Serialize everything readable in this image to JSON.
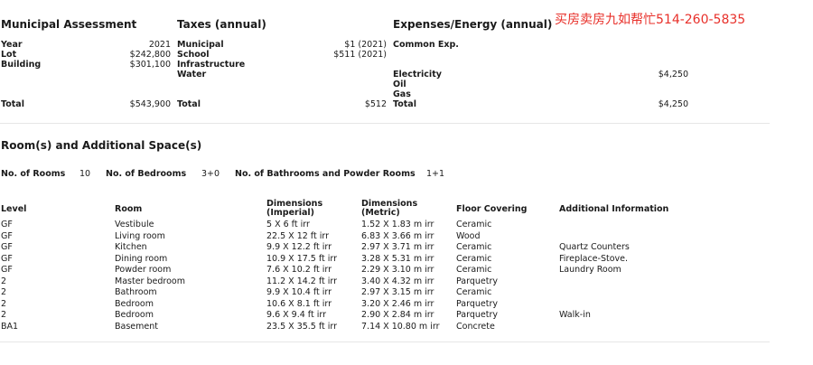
{
  "promo": "买房卖房九如帮忙514-260-5835",
  "assessment": {
    "title": "Municipal Assessment",
    "rows": [
      {
        "label": "Year",
        "value": "2021"
      },
      {
        "label": "Lot",
        "value": "$242,800"
      },
      {
        "label": "Building",
        "value": "$301,100"
      }
    ],
    "total_label": "Total",
    "total_value": "$543,900"
  },
  "taxes": {
    "title": "Taxes (annual)",
    "rows": [
      {
        "label": "Municipal",
        "value": "$1 (2021)"
      },
      {
        "label": "School",
        "value": "$511 (2021)"
      },
      {
        "label": "Infrastructure",
        "value": ""
      },
      {
        "label": "Water",
        "value": ""
      }
    ],
    "total_label": "Total",
    "total_value": "$512"
  },
  "expenses": {
    "title": "Expenses/Energy (annual)",
    "rows": [
      {
        "label": "Common Exp.",
        "value": ""
      },
      {
        "label": "Electricity",
        "value": "$4,250"
      },
      {
        "label": "Oil",
        "value": ""
      },
      {
        "label": "Gas",
        "value": ""
      }
    ],
    "total_label": "Total",
    "total_value": "$4,250"
  },
  "rooms_section": {
    "title": "Room(s) and Additional Space(s)",
    "no_rooms_label": "No. of Rooms",
    "no_rooms_value": "10",
    "no_bedrooms_label": "No. of Bedrooms",
    "no_bedrooms_value": "3+0",
    "no_baths_label": "No. of Bathrooms and Powder Rooms",
    "no_baths_value": "1+1"
  },
  "room_table": {
    "headers": {
      "level": "Level",
      "room": "Room",
      "dim_imp_1": "Dimensions",
      "dim_imp_2": "(Imperial)",
      "dim_met_1": "Dimensions",
      "dim_met_2": "(Metric)",
      "floor": "Floor Covering",
      "info": "Additional Information"
    },
    "rows": [
      {
        "level": "GF",
        "room": "Vestibule",
        "imperial": "5 X 6 ft irr",
        "metric": "1.52 X 1.83 m irr",
        "floor": "Ceramic",
        "info": ""
      },
      {
        "level": "GF",
        "room": "Living room",
        "imperial": "22.5 X 12 ft irr",
        "metric": "6.83 X 3.66 m irr",
        "floor": "Wood",
        "info": ""
      },
      {
        "level": "GF",
        "room": "Kitchen",
        "imperial": "9.9 X 12.2 ft irr",
        "metric": "2.97 X 3.71 m irr",
        "floor": "Ceramic",
        "info": "Quartz Counters"
      },
      {
        "level": "GF",
        "room": "Dining room",
        "imperial": "10.9 X 17.5 ft irr",
        "metric": "3.28 X 5.31 m irr",
        "floor": "Ceramic",
        "info": "Fireplace-Stove."
      },
      {
        "level": "GF",
        "room": "Powder room",
        "imperial": "7.6 X 10.2 ft irr",
        "metric": "2.29 X 3.10 m irr",
        "floor": "Ceramic",
        "info": "Laundry Room"
      },
      {
        "level": "2",
        "room": "Master bedroom",
        "imperial": "11.2 X 14.2 ft irr",
        "metric": "3.40 X 4.32 m irr",
        "floor": "Parquetry",
        "info": ""
      },
      {
        "level": "2",
        "room": "Bathroom",
        "imperial": "9.9 X 10.4 ft irr",
        "metric": "2.97 X 3.15 m irr",
        "floor": "Ceramic",
        "info": ""
      },
      {
        "level": "2",
        "room": "Bedroom",
        "imperial": "10.6 X 8.1 ft irr",
        "metric": "3.20 X 2.46 m irr",
        "floor": "Parquetry",
        "info": ""
      },
      {
        "level": "2",
        "room": "Bedroom",
        "imperial": "9.6 X 9.4 ft irr",
        "metric": "2.90 X 2.84 m irr",
        "floor": "Parquetry",
        "info": "Walk-in"
      },
      {
        "level": "BA1",
        "room": "Basement",
        "imperial": "23.5 X 35.5 ft irr",
        "metric": "7.14 X 10.80 m irr",
        "floor": "Concrete",
        "info": ""
      }
    ]
  },
  "colors": {
    "promo": "#e8302a",
    "divider": "#e6e6e6",
    "text": "#1a1a1a"
  }
}
